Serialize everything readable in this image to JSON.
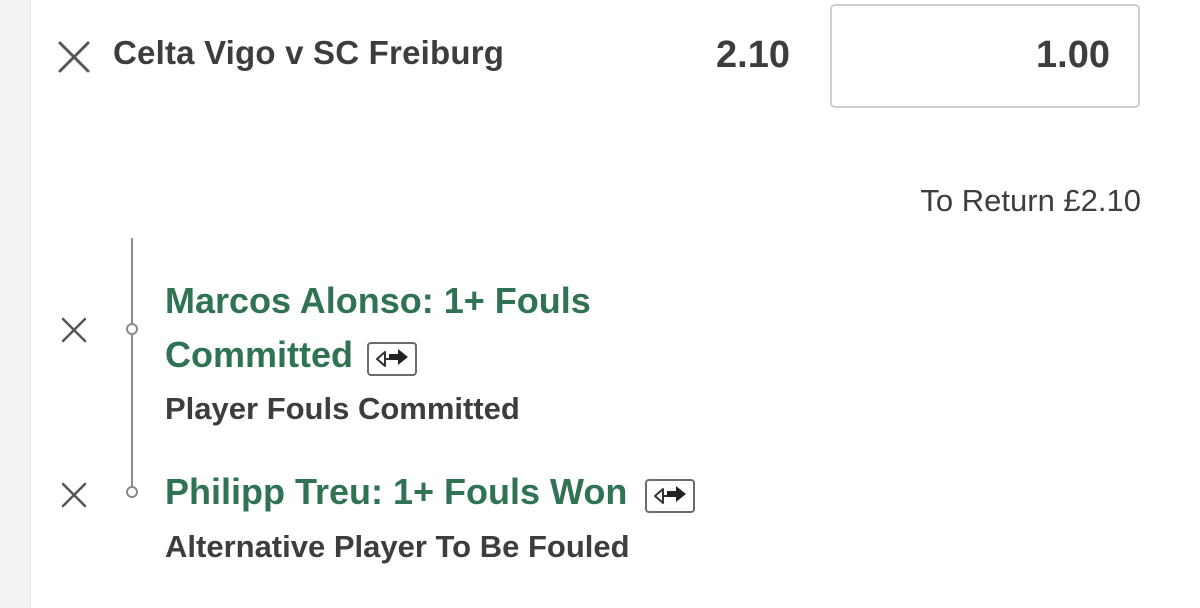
{
  "bet": {
    "match": "Celta Vigo v SC Freiburg",
    "odds": "2.10",
    "stake": "1.00",
    "to_return": "To Return £2.10"
  },
  "selections": [
    {
      "title_line1": "Marcos Alonso: 1+ Fouls",
      "title_line2": "Committed",
      "market": "Player Fouls Committed",
      "icon": "swap-arrows-icon"
    },
    {
      "title_line1": "Philipp Treu: 1+ Fouls Won",
      "market": "Alternative Player To Be Fouled",
      "icon": "swap-arrows-icon"
    }
  ],
  "colors": {
    "selection_green": "#2f7254",
    "text_dark": "#3d3d3d"
  }
}
